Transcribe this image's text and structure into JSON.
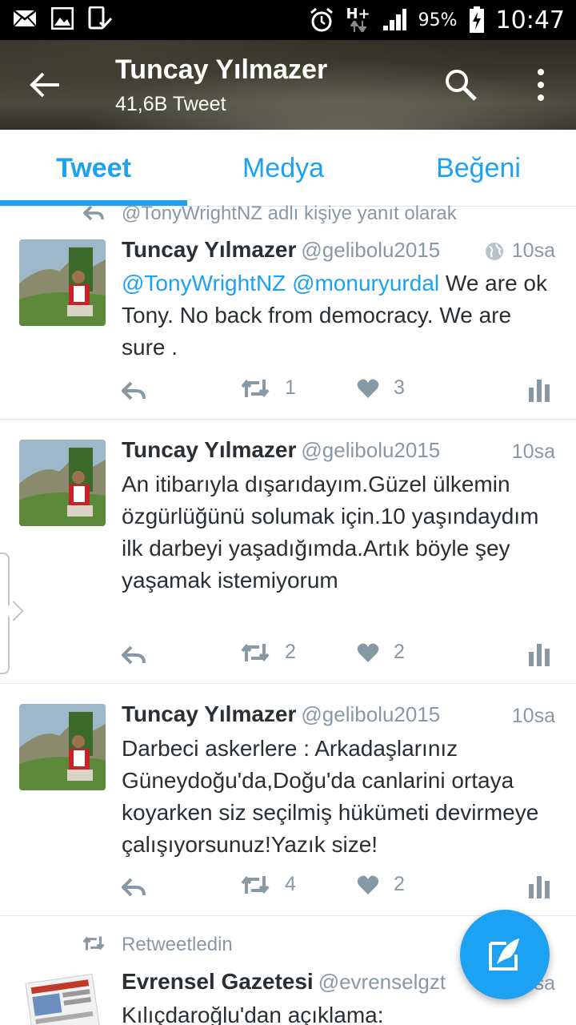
{
  "status_bar": {
    "battery": "95%",
    "time": "10:47",
    "network": "H+"
  },
  "header": {
    "title": "Tuncay Yılmazer",
    "subtitle": "41,6B Tweet"
  },
  "tabs": [
    {
      "label": "Tweet",
      "active": true
    },
    {
      "label": "Medya"
    },
    {
      "label": "Beğeni"
    }
  ],
  "reply_context": "@TonyWrightNZ adlı kişiye yanıt olarak",
  "tweets": [
    {
      "name": "Tuncay Yılmazer",
      "handle": "@gelibolu2015",
      "time": "10sa",
      "mentions": "@TonyWrightNZ @monuryurdal",
      "text": " We are ok Tony. No back from democracy. We are sure .",
      "retweets": "1",
      "likes": "3"
    },
    {
      "name": "Tuncay Yılmazer",
      "handle": "@gelibolu2015",
      "time": "10sa",
      "text": "An itibarıyla dışarıdayım.Güzel ülkemin özgürlüğünü solumak için.10 yaşındaydım ilk darbeyi yaşadığımda.Artık böyle şey yaşamak istemiyorum",
      "retweets": "2",
      "likes": "2"
    },
    {
      "name": "Tuncay Yılmazer",
      "handle": "@gelibolu2015",
      "time": "10sa",
      "text": "Darbeci askerlere : Arkadaşlarınız Güneydoğu'da,Doğu'da canlarini ortaya koyarken siz seçilmiş hükümeti devirmeye çalışıyorsunuz!Yazık size!",
      "retweets": "4",
      "likes": "2"
    },
    {
      "retweet_context": "Retweetledin",
      "name": "Evrensel Gazetesi",
      "handle": "@evrenselgzt",
      "time": "sa",
      "text": "Kılıçdaroğlu'dan açıklama:"
    }
  ],
  "colors": {
    "accent": "#1da1f2",
    "muted": "#8899a6",
    "text": "#292f33"
  }
}
